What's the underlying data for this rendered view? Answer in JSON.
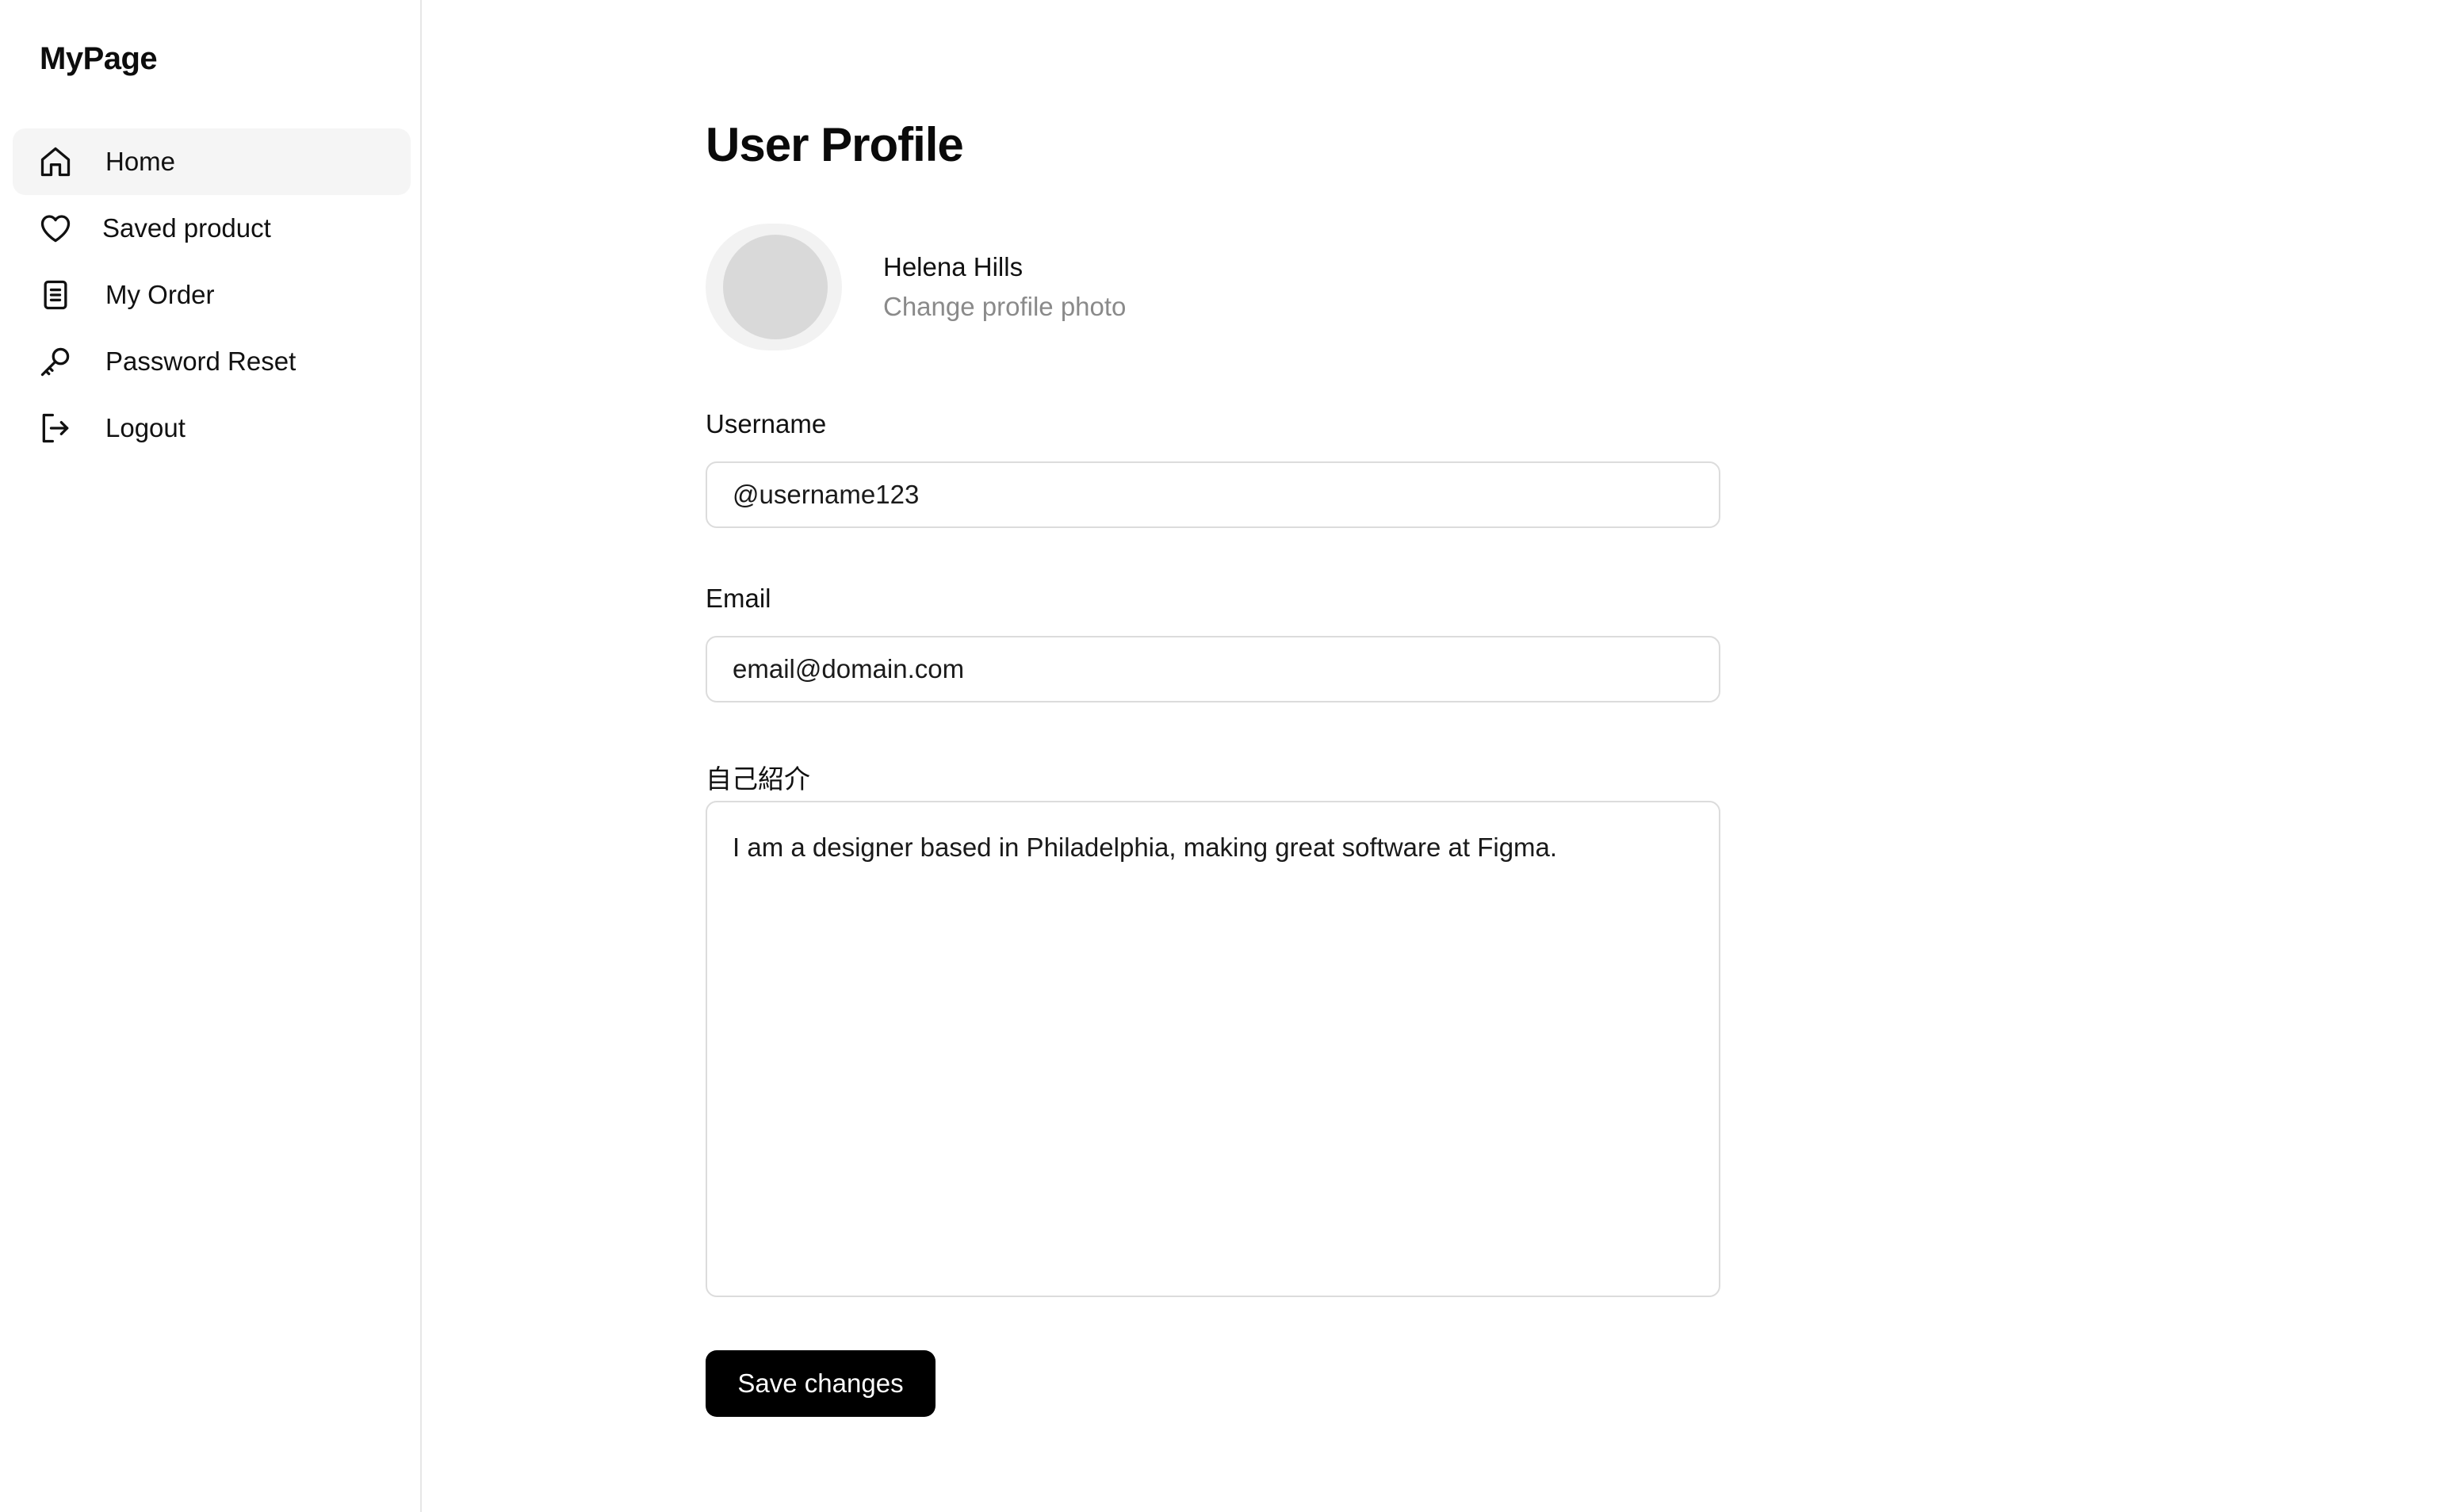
{
  "sidebar": {
    "brand": "MyPage",
    "items": [
      {
        "label": "Home",
        "icon": "home-icon",
        "active": true
      },
      {
        "label": "Saved product",
        "icon": "heart-icon",
        "active": false
      },
      {
        "label": "My Order",
        "icon": "document-icon",
        "active": false
      },
      {
        "label": "Password Reset",
        "icon": "key-icon",
        "active": false
      },
      {
        "label": "Logout",
        "icon": "logout-icon",
        "active": false
      }
    ]
  },
  "main": {
    "title": "User Profile",
    "profile": {
      "name": "Helena Hills",
      "change_photo": "Change profile photo"
    },
    "form": {
      "username": {
        "label": "Username",
        "value": "@username123"
      },
      "email": {
        "label": "Email",
        "value": "email@domain.com"
      },
      "bio": {
        "label": "自己紹介",
        "value": "I am a designer based in Philadelphia, making great software at Figma."
      },
      "save_label": "Save changes"
    }
  },
  "colors": {
    "active_nav_bg": "#f5f5f5",
    "button_bg": "#000000",
    "avatar_placeholder": "#d9d9d9",
    "muted_text": "#8a8a8a",
    "border": "#dcdcdc"
  }
}
